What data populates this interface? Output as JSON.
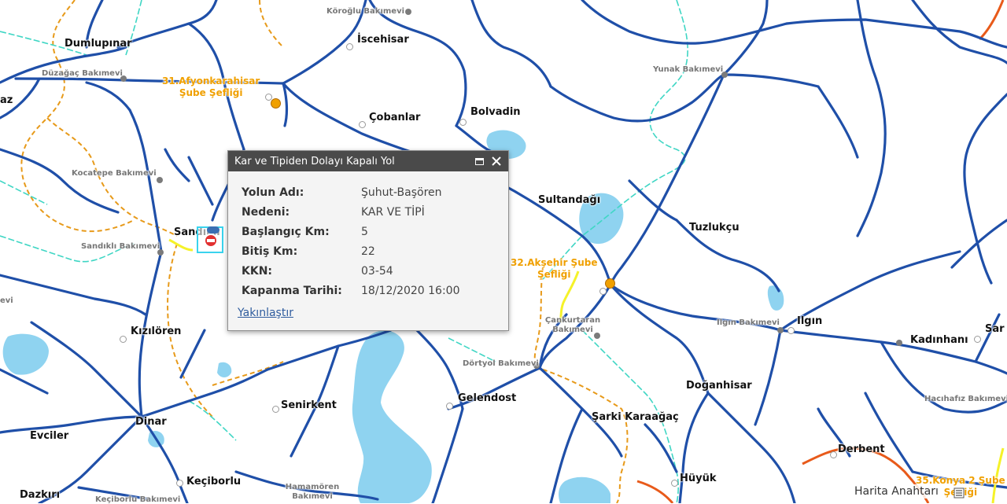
{
  "map": {
    "cities": [
      {
        "key": "dumlupinar",
        "text": "Dumlupınar"
      },
      {
        "key": "az",
        "text": "az"
      },
      {
        "key": "iscehisar",
        "text": "İscehisar"
      },
      {
        "key": "cobanlar",
        "text": "Çobanlar"
      },
      {
        "key": "bolvadin",
        "text": "Bolvadin"
      },
      {
        "key": "sultandagi",
        "text": "Sultandağı"
      },
      {
        "key": "tuzlukcu",
        "text": "Tuzlukçu"
      },
      {
        "key": "ilgin",
        "text": "Ilgın"
      },
      {
        "key": "kadinhani",
        "text": "Kadınhanı"
      },
      {
        "key": "sar",
        "text": "Sar"
      },
      {
        "key": "doganhisar",
        "text": "Doğanhisar"
      },
      {
        "key": "sandikli",
        "text": "Sandıklı"
      },
      {
        "key": "kiziloren",
        "text": "Kızılören"
      },
      {
        "key": "senirkent",
        "text": "Senirkent"
      },
      {
        "key": "gelendost",
        "text": "Gelendost"
      },
      {
        "key": "sarki_karaagac",
        "text": "Şarki Karaağaç"
      },
      {
        "key": "dinar",
        "text": "Dinar"
      },
      {
        "key": "evciler",
        "text": "Evciler"
      },
      {
        "key": "keciborlu",
        "text": "Keçiborlu"
      },
      {
        "key": "dazkiri",
        "text": "Dazkırı"
      },
      {
        "key": "huyuk",
        "text": "Hüyük"
      },
      {
        "key": "derbent",
        "text": "Derbent"
      }
    ],
    "maintenance": [
      {
        "key": "koroglu",
        "text": "Köroğlu Bakımevi"
      },
      {
        "key": "duzagac",
        "text": "Düzağaç Bakımevi"
      },
      {
        "key": "yunak",
        "text": "Yunak Bakımevi"
      },
      {
        "key": "kocatepe",
        "text": "Kocatepe Bakımevi"
      },
      {
        "key": "sandikli",
        "text": "Sandıklı Bakımevi"
      },
      {
        "key": "cankurtaran",
        "text": "Çankurtaran Bakımevi"
      },
      {
        "key": "ilgin",
        "text": "Ilgın Bakımevi"
      },
      {
        "key": "dortyol",
        "text": "Dörtyol Bakımevi"
      },
      {
        "key": "hacihafiz",
        "text": "Hacıhafız Bakımevi"
      },
      {
        "key": "evi",
        "text": "evi"
      },
      {
        "key": "keciborlu",
        "text": "Keçiborlu Bakımevi"
      },
      {
        "key": "hamamoren",
        "text": "Hamamören Bakımevi"
      }
    ],
    "branches": [
      {
        "key": "afyon",
        "line1": "31.Afyonkarahisar",
        "line2": "Şube Şefliği"
      },
      {
        "key": "aksehir",
        "line1": "32.Akşehir Şube",
        "line2": "Şefliği"
      },
      {
        "key": "konya",
        "line1": "35.Konya 2 Şube",
        "line2": "Şefliği"
      }
    ],
    "colors": {
      "main_road": "#1f4fa8",
      "water": "#8fd3f0",
      "closed_road": "#f5f229",
      "branch_label": "#f0a000",
      "boundary": "#e79a1a",
      "rail": "#3fd6c4",
      "state_road": "#e85a1a"
    }
  },
  "popup": {
    "title": "Kar ve Tipiden Dolayı Kapalı Yol",
    "maximize_icon": "maximize-icon",
    "close_icon": "close-icon",
    "fields": [
      {
        "label": "Yolun Adı:",
        "value": "Şuhut-Başören"
      },
      {
        "label": "Nedeni:",
        "value": "KAR VE TİPİ"
      },
      {
        "label": "Başlangıç Km:",
        "value": "5"
      },
      {
        "label": "Bitiş Km:",
        "value": "22"
      },
      {
        "label": "KKN:",
        "value": "03-54"
      },
      {
        "label": "Kapanma Tarihi:",
        "value": "18/12/2020 16:00"
      }
    ],
    "zoom_link": "Yakınlaştır"
  },
  "legend": {
    "label": "Harita Anahtarı",
    "icon": "legend-icon"
  }
}
